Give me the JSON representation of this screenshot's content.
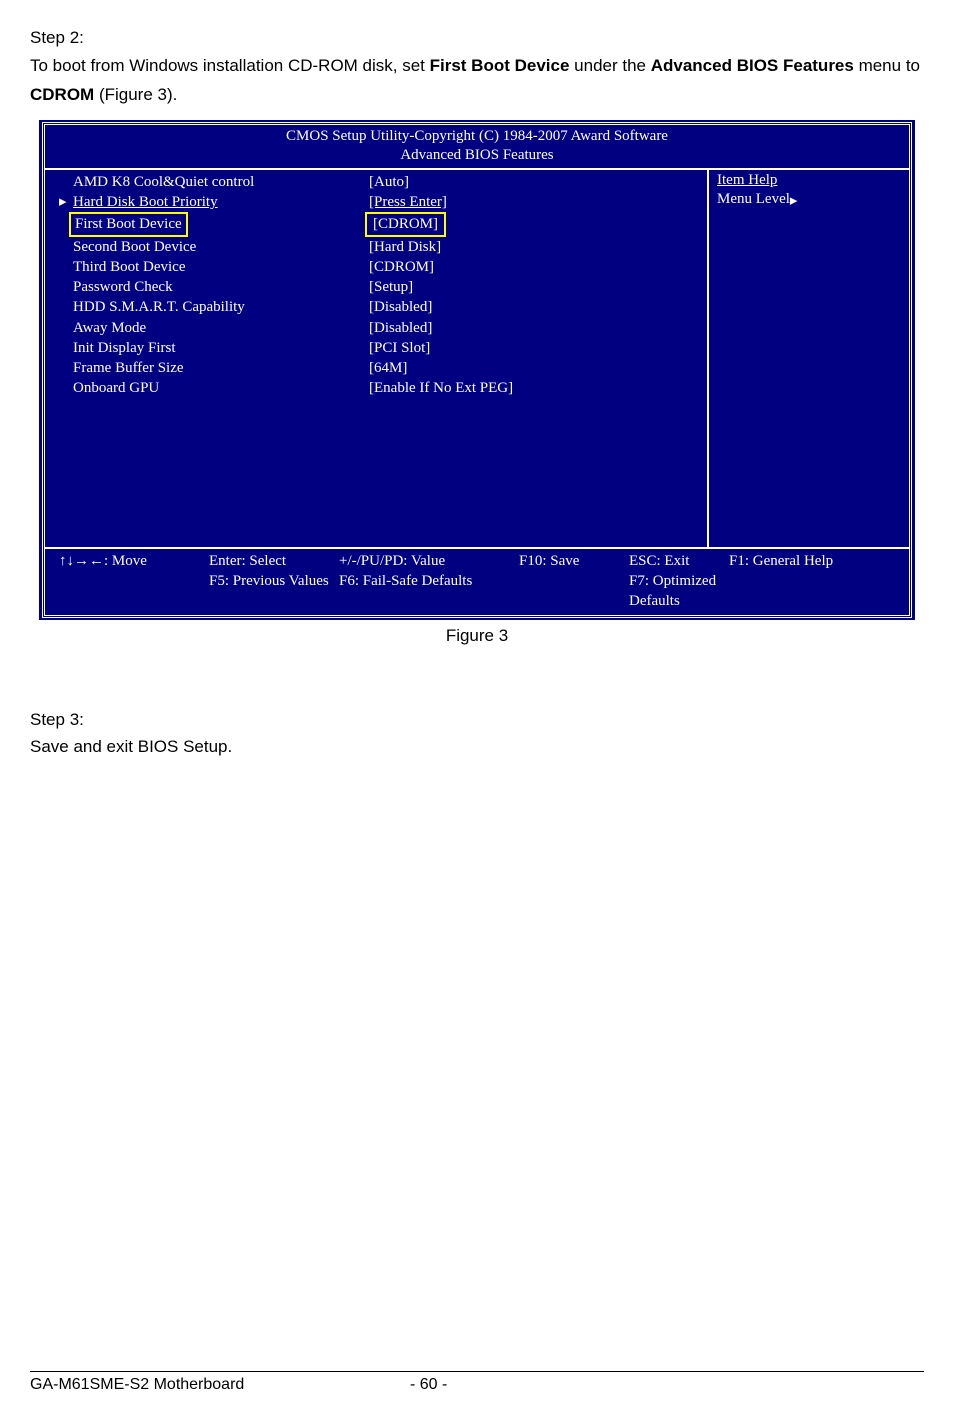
{
  "doc": {
    "step2_heading": "Step 2:",
    "intro_prefix": "To boot from Windows installation CD-ROM disk, set ",
    "intro_bold1": "First Boot Device",
    "intro_mid": " under the ",
    "intro_bold2": "Advanced BIOS Features",
    "intro_suffix_prefix": " menu to ",
    "intro_bold3": "CDROM ",
    "intro_suffix_end": " (Figure 3).",
    "figure_caption": "Figure 3",
    "step3_heading": "Step 3:",
    "step3_text": "Save and exit BIOS Setup."
  },
  "bios": {
    "header_line1": "CMOS Setup Utility-Copyright (C) 1984-2007 Award Software",
    "header_line2": "Advanced BIOS Features",
    "rows": [
      {
        "label": "AMD K8 Cool&Quiet control",
        "value": "[Auto]",
        "pointer": false
      },
      {
        "label": "Hard Disk Boot Priority",
        "value": "[Press Enter]",
        "pointer": true,
        "underline": true
      },
      {
        "label": "First Boot Device",
        "value": "[CDROM]",
        "pointer": false,
        "hl_label": true,
        "hl_value": true
      },
      {
        "label": "Second Boot Device",
        "value": "[Hard Disk]",
        "pointer": false
      },
      {
        "label": "Third Boot Device",
        "value": "[CDROM]",
        "pointer": false
      },
      {
        "label": "Password Check",
        "value": "[Setup]",
        "pointer": false
      },
      {
        "label": "HDD S.M.A.R.T. Capability",
        "value": "[Disabled]",
        "pointer": false
      },
      {
        "label": "Away Mode",
        "value": "[Disabled]",
        "pointer": false
      },
      {
        "label": "Init Display First",
        "value": "[PCI Slot]",
        "pointer": false
      },
      {
        "label": "Frame Buffer Size",
        "value": "[64M]",
        "pointer": false
      },
      {
        "label": "Onboard GPU",
        "value": "[Enable If No Ext PEG]",
        "pointer": false
      }
    ],
    "help": {
      "title": "Item Help",
      "menu_level": "Menu Level"
    },
    "footer": {
      "move": "↑↓→←: Move",
      "enter": "Enter: Select",
      "value": "+/-/PU/PD: Value",
      "save": "F10: Save",
      "exit": "ESC: Exit",
      "help_f1": "F1: General Help",
      "prev": "F5: Previous Values",
      "failsafe": "F6: Fail-Safe Defaults",
      "optimized": "F7: Optimized Defaults"
    }
  },
  "page_footer": {
    "left": "GA-M61SME-S2 Motherboard",
    "center": "- 60 -"
  }
}
